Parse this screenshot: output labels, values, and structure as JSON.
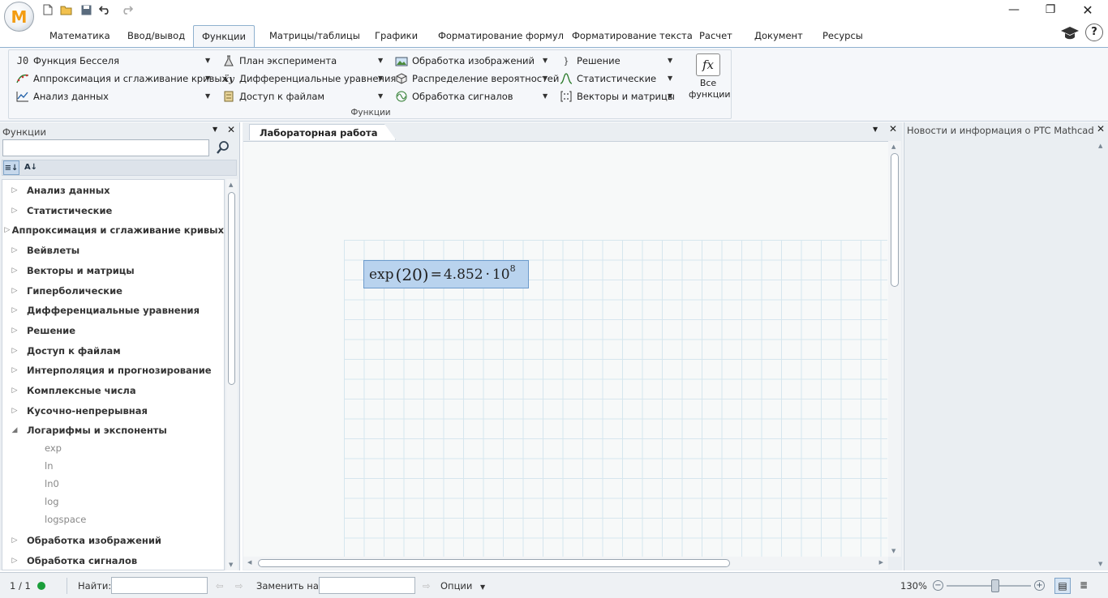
{
  "app": {
    "logo_letter": "M"
  },
  "titlebar": {
    "minimize": "—",
    "restore": "❐",
    "close": "✕"
  },
  "ribbon_tabs": [
    "Математика",
    "Ввод/вывод",
    "Функции",
    "Матрицы/таблицы",
    "Графики",
    "Форматирование формул",
    "Форматирование текста",
    "Расчет",
    "Документ",
    "Ресурсы"
  ],
  "active_tab": "Функции",
  "ribbon": {
    "col1": [
      "Функция Бесселя",
      "Аппроксимация и сглаживание кривых",
      "Анализ данных"
    ],
    "col1_icons": [
      "J0",
      "bessel-curve-icon",
      "chart-icon"
    ],
    "col2": [
      "План эксперимента",
      "Дифференциальные уравнения",
      "Доступ к файлам"
    ],
    "col3": [
      "Обработка изображений",
      "Распределение вероятностей",
      "Обработка сигналов"
    ],
    "col4": [
      "Решение",
      "Статистические",
      "Векторы и матрицы"
    ],
    "all_functions": {
      "icon": "fx",
      "label_line1": "Все",
      "label_line2": "функции"
    },
    "group_name": "Функции",
    "help": "?"
  },
  "left_panel": {
    "title": "Функции",
    "search_value": "",
    "categories_before": [
      "Анализ данных",
      "Статистические",
      "Аппроксимация и сглаживание кривых",
      "Вейвлеты",
      "Векторы и матрицы",
      "Гиперболические",
      "Дифференциальные уравнения",
      "Решение",
      "Доступ к файлам",
      "Интерполяция и прогнозирование",
      "Комплексные числа",
      "Кусочно-непрерывная"
    ],
    "expanded_category": "Логарифмы и экспоненты",
    "expanded_items": [
      "exp",
      "ln",
      "ln0",
      "log",
      "logspace"
    ],
    "categories_after": [
      "Обработка изображений",
      "Обработка сигналов"
    ]
  },
  "document": {
    "tab_title": "Лабораторная работа",
    "math_region": {
      "expr": "exp",
      "arg": "(20)",
      "eq": "=",
      "mantissa": "4.852",
      "dot": "·",
      "base": "10",
      "exponent": "8"
    }
  },
  "right_panel": {
    "title": "Новости и информация о PTC Mathcad"
  },
  "status_bar": {
    "page": "1 / 1",
    "find_label": "Найти:",
    "find_value": "",
    "replace_label": "Заменить на:",
    "replace_value": "",
    "options_label": "Опции",
    "zoom": "130%",
    "zoom_level_percent": 130,
    "status_color": "#1a9e3a"
  }
}
